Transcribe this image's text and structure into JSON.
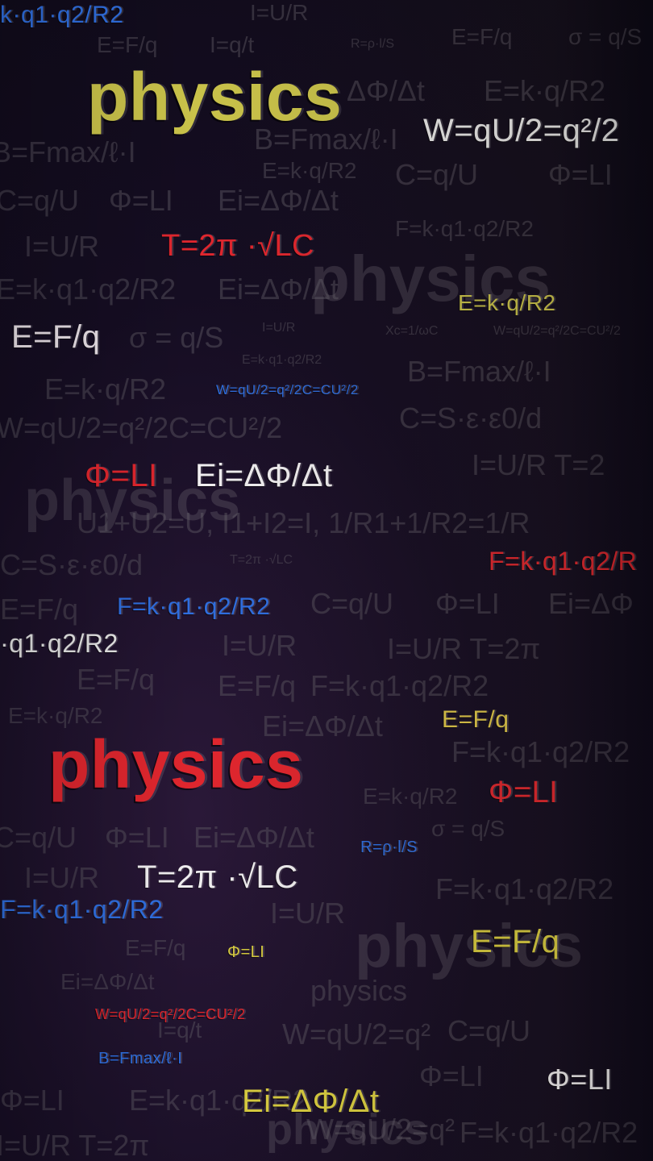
{
  "word": "physics",
  "highlight": [
    {
      "text": "k·q1·q2/R2",
      "color": "#2f6ee0"
    },
    {
      "text": "physics",
      "color": "#c9c24a"
    },
    {
      "text": "W=qU/2=q²/2",
      "color": "#e8e8e8"
    },
    {
      "text": "T=2π ·√LC",
      "color": "#e0262e"
    },
    {
      "text": "E=k·q/R2",
      "color": "#c9c24a"
    },
    {
      "text": "E=F/q",
      "color": "#ece4ea"
    },
    {
      "text": "W=qU/2=q²/2C=CU²/2",
      "color": "#2f6ee0"
    },
    {
      "text": "Φ=LI",
      "color": "#e0262e"
    },
    {
      "text": "Ei=ΔΦ/Δt",
      "color": "#f0eef0"
    },
    {
      "text": "F=k·q1·q2/R",
      "color": "#e0262e"
    },
    {
      "text": "F=k·q1·q2/R2",
      "color": "#2f6ee0"
    },
    {
      "text": "·q1·q2/R2",
      "color": "#e8e8e8"
    },
    {
      "text": "E=F/q",
      "color": "#e0c84a"
    },
    {
      "text": "physics",
      "color": "#e0262e"
    },
    {
      "text": "Φ=LI",
      "color": "#e0262e"
    },
    {
      "text": "R=ρ·l/S",
      "color": "#2f6ee0"
    },
    {
      "text": "T=2π ·√LC",
      "color": "#f0eef0"
    },
    {
      "text": "F=k·q1·q2/R2",
      "color": "#2f6ee0"
    },
    {
      "text": "E=F/q",
      "color": "#d8cc40"
    },
    {
      "text": "Φ=LI",
      "color": "#d8cc40"
    },
    {
      "text": "W=qU/2=q²/2C=CU²/2",
      "color": "#e0262e"
    },
    {
      "text": "B=Fmax/ℓ·I",
      "color": "#2f6ee0"
    },
    {
      "text": "Φ=LI",
      "color": "#f0eef0"
    },
    {
      "text": "Ei=ΔΦ/Δt",
      "color": "#d8cc40"
    }
  ],
  "background": [
    "I=U/R",
    "E=F/q",
    "I=q/t",
    "R=ρ·l/S",
    "σ = q/S",
    "E=k·q/R2",
    "ΔΦ/Δt",
    "B=Fmax/ℓ·I",
    "C=q/U",
    "Φ=LI",
    "Ei=ΔΦ/Δt",
    "F=k·q1·q2/R2",
    "I=U/R",
    "physics",
    "E=F/q",
    "E=k·q1·q2/R2",
    "Xc=1/ωC",
    "W=qU/2=q²/2C=CU²/2",
    "I=U/R T=2",
    "U1+U2=U, I1+I2=I, 1/R1+1/R2=1/R",
    "C=S·ε·ε0/d",
    "T=2π ·√LC",
    "C=q/U",
    "Φ=LI",
    "Ei=ΔΦ",
    "I=U/R",
    "T=2π ·√LC",
    "E=F/q",
    "F=k·q1·q2/R2",
    "Ei=ΔΦ/Δt",
    "E=k·q/R2",
    "F=k·q1·q2/R2",
    "I=U/R",
    "E=k·q/R2",
    "σ = q/S",
    "E=F/q",
    "Ei=ΔΦ/Δt",
    "physics",
    "I=q/t",
    "W=qU/2=q²",
    "C=q/U",
    "Φ=LI",
    "E=k·q1·q2/R2",
    "I=U/R T=2π"
  ],
  "watermarks": [
    "physics",
    "physics",
    "physics",
    "physics"
  ]
}
